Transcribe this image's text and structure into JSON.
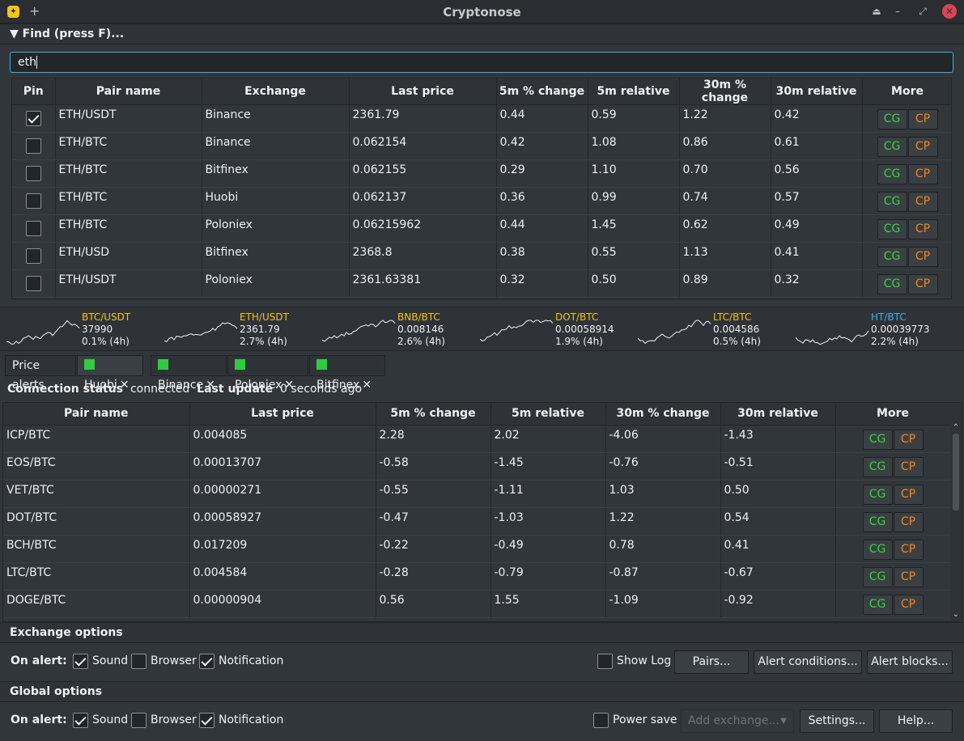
{
  "window": {
    "title": "Cryptonose",
    "app_icon": "cryptonose-logo-icon",
    "new_tab": "+"
  },
  "find": {
    "header": "Find (press F)...",
    "query": "eth"
  },
  "search_table": {
    "headers": [
      "Pin",
      "Pair name",
      "Exchange",
      "Last price",
      "5m % change",
      "5m relative",
      "30m % change",
      "30m relative",
      "More"
    ],
    "rows": [
      {
        "pinned": true,
        "pair": "ETH/USDT",
        "exchange": "Binance",
        "price": "2361.79",
        "c5": "0.44",
        "r5": "0.59",
        "c30": "1.22",
        "r30": "0.42"
      },
      {
        "pinned": false,
        "pair": "ETH/BTC",
        "exchange": "Binance",
        "price": "0.062154",
        "c5": "0.42",
        "r5": "1.08",
        "c30": "0.86",
        "r30": "0.61"
      },
      {
        "pinned": false,
        "pair": "ETH/BTC",
        "exchange": "Bitfinex",
        "price": "0.062155",
        "c5": "0.29",
        "r5": "1.10",
        "c30": "0.70",
        "r30": "0.56"
      },
      {
        "pinned": false,
        "pair": "ETH/BTC",
        "exchange": "Huobi",
        "price": "0.062137",
        "c5": "0.36",
        "r5": "0.99",
        "c30": "0.74",
        "r30": "0.57"
      },
      {
        "pinned": false,
        "pair": "ETH/BTC",
        "exchange": "Poloniex",
        "price": "0.06215962",
        "c5": "0.44",
        "r5": "1.45",
        "c30": "0.62",
        "r30": "0.49"
      },
      {
        "pinned": false,
        "pair": "ETH/USD",
        "exchange": "Bitfinex",
        "price": "2368.8",
        "c5": "0.38",
        "r5": "0.55",
        "c30": "1.13",
        "r30": "0.41"
      },
      {
        "pinned": false,
        "pair": "ETH/USDT",
        "exchange": "Poloniex",
        "price": "2361.63381",
        "c5": "0.32",
        "r5": "0.50",
        "c30": "0.89",
        "r30": "0.32"
      }
    ],
    "cg_label": "CG",
    "cp_label": "CP"
  },
  "sparklines": [
    {
      "pair": "BTC/USDT",
      "price": "37990",
      "change": "0.1% (4h)",
      "color": "#f0c419"
    },
    {
      "pair": "ETH/USDT",
      "price": "2361.79",
      "change": "2.7% (4h)",
      "color": "#f0c419"
    },
    {
      "pair": "BNB/BTC",
      "price": "0.008146",
      "change": "2.6% (4h)",
      "color": "#f0c419"
    },
    {
      "pair": "DOT/BTC",
      "price": "0.00058914",
      "change": "1.9% (4h)",
      "color": "#f0c419"
    },
    {
      "pair": "LTC/BTC",
      "price": "0.004586",
      "change": "0.5% (4h)",
      "color": "#f0c419"
    },
    {
      "pair": "HT/BTC",
      "price": "0.00039773",
      "change": "2.2% (4h)",
      "color": "#3daee9"
    }
  ],
  "tabs": [
    {
      "label": "Price alerts",
      "closable": false
    },
    {
      "label": "Huobi",
      "closable": true,
      "active": true
    },
    {
      "label": "Binance",
      "closable": true
    },
    {
      "label": "Poloniex",
      "closable": true
    },
    {
      "label": "Bitfinex",
      "closable": true
    }
  ],
  "status": {
    "conn_label": "Connection status",
    "conn_value": "connected",
    "update_label": "Last update",
    "update_value": "0 seconds ago"
  },
  "exchange_table": {
    "headers": [
      "Pair name",
      "Last price",
      "5m % change",
      "5m relative",
      "30m % change",
      "30m relative",
      "More"
    ],
    "rows": [
      {
        "pair": "ICP/BTC",
        "price": "0.004085",
        "c5": "2.28",
        "r5": "2.02",
        "c30": "-4.06",
        "r30": "-1.43"
      },
      {
        "pair": "EOS/BTC",
        "price": "0.00013707",
        "c5": "-0.58",
        "r5": "-1.45",
        "c30": "-0.76",
        "r30": "-0.51"
      },
      {
        "pair": "VET/BTC",
        "price": "0.00000271",
        "c5": "-0.55",
        "r5": "-1.11",
        "c30": "1.03",
        "r30": "0.50"
      },
      {
        "pair": "DOT/BTC",
        "price": "0.00058927",
        "c5": "-0.47",
        "r5": "-1.03",
        "c30": "1.22",
        "r30": "0.54"
      },
      {
        "pair": "BCH/BTC",
        "price": "0.017209",
        "c5": "-0.22",
        "r5": "-0.49",
        "c30": "0.78",
        "r30": "0.41"
      },
      {
        "pair": "LTC/BTC",
        "price": "0.004584",
        "c5": "-0.28",
        "r5": "-0.79",
        "c30": "-0.87",
        "r30": "-0.67"
      },
      {
        "pair": "DOGE/BTC",
        "price": "0.00000904",
        "c5": "0.56",
        "r5": "1.55",
        "c30": "-1.09",
        "r30": "-0.92"
      }
    ]
  },
  "exchange_options": {
    "header": "Exchange options",
    "on_alert": "On alert:",
    "sound": "Sound",
    "sound_checked": true,
    "browser": "Browser",
    "browser_checked": false,
    "notification": "Notification",
    "notification_checked": true,
    "show_log": "Show Log",
    "show_log_checked": false,
    "pairs_btn": "Pairs...",
    "alert_conditions_btn": "Alert conditions...",
    "alert_blocks_btn": "Alert blocks..."
  },
  "global_options": {
    "header": "Global options",
    "on_alert": "On alert:",
    "sound": "Sound",
    "sound_checked": true,
    "browser": "Browser",
    "browser_checked": false,
    "notification": "Notification",
    "notification_checked": true,
    "power_save": "Power save",
    "power_save_checked": false,
    "add_exchange": "Add exchange...",
    "settings_btn": "Settings...",
    "help_btn": "Help..."
  },
  "colors": {
    "positive": "#3bd33b",
    "negative": "#ef3b3b",
    "accent": "#3daee9",
    "cp": "#f0861e",
    "highlight": "#f0c419"
  }
}
